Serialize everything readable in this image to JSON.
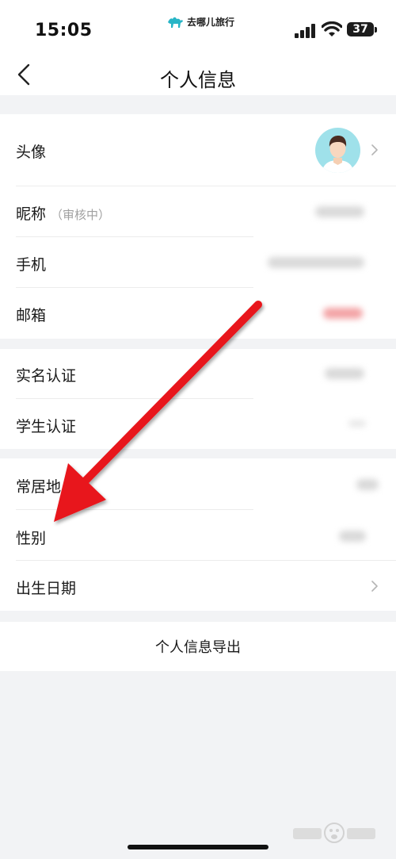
{
  "status_bar": {
    "time": "15:05",
    "app_name": "去哪儿旅行",
    "battery": "37"
  },
  "header": {
    "title": "个人信息",
    "back_icon": "chevron-left-icon"
  },
  "profile_items": [
    {
      "label": "头像",
      "note": ""
    },
    {
      "label": "昵称",
      "note": "（审核中）"
    },
    {
      "label": "手机",
      "note": ""
    },
    {
      "label": "邮箱",
      "note": ""
    }
  ],
  "auth_items": [
    {
      "label": "实名认证"
    },
    {
      "label": "学生认证"
    }
  ],
  "other_items": [
    {
      "label": "常居地"
    },
    {
      "label": "性别"
    },
    {
      "label": "出生日期"
    }
  ],
  "export": {
    "label": "个人信息导出"
  },
  "annotation": {
    "color": "#e8141a"
  },
  "colors": {
    "accent_avatar": "#9fe1ea",
    "page_bg": "#f2f3f5"
  }
}
